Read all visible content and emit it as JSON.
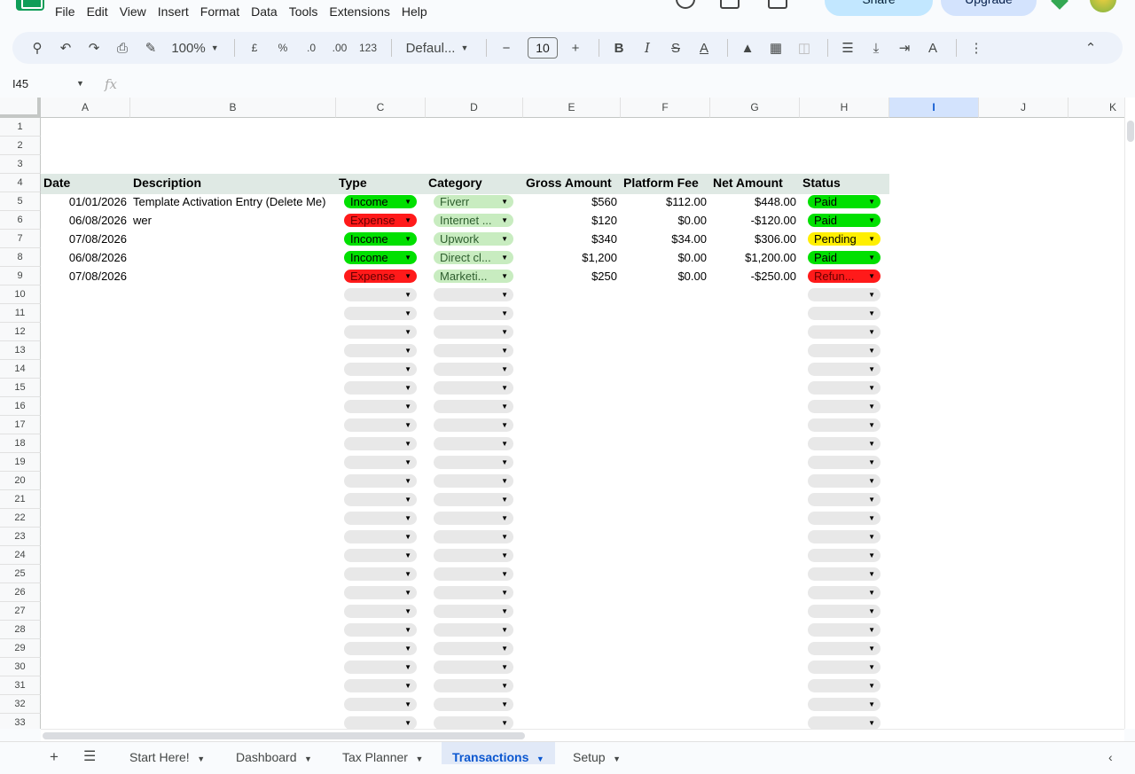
{
  "menu": [
    "File",
    "Edit",
    "View",
    "Insert",
    "Format",
    "Data",
    "Tools",
    "Extensions",
    "Help"
  ],
  "top": {
    "share": "Share",
    "upgrade": "Upgrade"
  },
  "toolbar": {
    "zoom": "100%",
    "currency": "£",
    "percent": "%",
    "dec_less": ".0",
    "dec_more": ".00",
    "number_format": "123",
    "font": "Defaul...",
    "font_size": "10"
  },
  "formula": {
    "namebox": "I45",
    "fx": "fx"
  },
  "columns": [
    {
      "label": "A",
      "w": 101
    },
    {
      "label": "B",
      "w": 232
    },
    {
      "label": "C",
      "w": 101
    },
    {
      "label": "D",
      "w": 110
    },
    {
      "label": "E",
      "w": 110
    },
    {
      "label": "F",
      "w": 101
    },
    {
      "label": "G",
      "w": 101
    },
    {
      "label": "H",
      "w": 101
    },
    {
      "label": "I",
      "w": 101,
      "selected": true
    },
    {
      "label": "J",
      "w": 101
    },
    {
      "label": "K",
      "w": 101
    }
  ],
  "headers": {
    "date": "Date",
    "description": "Description",
    "type": "Type",
    "category": "Category",
    "gross": "Gross Amount",
    "fee": "Platform Fee",
    "net": "Net Amount",
    "status": "Status"
  },
  "transactions": [
    {
      "date": "01/01/2026",
      "description": "Template Activation Entry (Delete Me)",
      "type": "Income",
      "category": "Fiverr",
      "gross": "$560",
      "fee": "$112.00",
      "net": "$448.00",
      "status": "Paid"
    },
    {
      "date": "06/08/2026",
      "description": "wer",
      "type": "Expense",
      "category": "Internet ...",
      "gross": "$120",
      "fee": "$0.00",
      "net": "-$120.00",
      "status": "Paid"
    },
    {
      "date": "07/08/2026",
      "description": "",
      "type": "Income",
      "category": "Upwork",
      "gross": "$340",
      "fee": "$34.00",
      "net": "$306.00",
      "status": "Pending"
    },
    {
      "date": "06/08/2026",
      "description": "",
      "type": "Income",
      "category": "Direct cl...",
      "gross": "$1,200",
      "fee": "$0.00",
      "net": "$1,200.00",
      "status": "Paid"
    },
    {
      "date": "07/08/2026",
      "description": "",
      "type": "Expense",
      "category": "Marketi...",
      "gross": "$250",
      "fee": "$0.00",
      "net": "-$250.00",
      "status": "Refun..."
    }
  ],
  "row_count": 33,
  "tabs": [
    {
      "label": "Start Here!"
    },
    {
      "label": "Dashboard"
    },
    {
      "label": "Tax Planner"
    },
    {
      "label": "Transactions",
      "active": true
    },
    {
      "label": "Setup"
    }
  ]
}
